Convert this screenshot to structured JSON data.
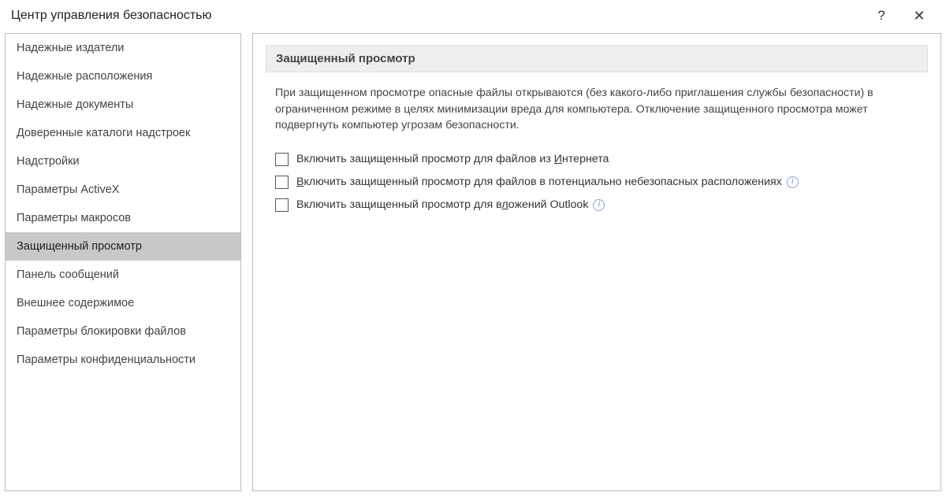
{
  "title": "Центр управления безопасностью",
  "help_glyph": "?",
  "close_glyph": "✕",
  "sidebar": {
    "items": [
      {
        "label": "Надежные издатели"
      },
      {
        "label": "Надежные расположения"
      },
      {
        "label": "Надежные документы"
      },
      {
        "label": "Доверенные каталоги надстроек"
      },
      {
        "label": "Надстройки"
      },
      {
        "label": "Параметры ActiveX"
      },
      {
        "label": "Параметры макросов"
      },
      {
        "label": "Защищенный просмотр"
      },
      {
        "label": "Панель сообщений"
      },
      {
        "label": "Внешнее содержимое"
      },
      {
        "label": "Параметры блокировки файлов"
      },
      {
        "label": "Параметры конфиденциальности"
      }
    ],
    "selected_index": 7
  },
  "main": {
    "section_title": "Защищенный просмотр",
    "description": "При защищенном просмотре опасные файлы открываются (без какого-либо приглашения службы безопасности) в ограниченном режиме в целях минимизации вреда для компьютера. Отключение защищенного просмотра может подвергнуть компьютер угрозам безопасности.",
    "options": [
      {
        "prefix": "Включить защищенный просмотр для файлов из ",
        "hotkey": "И",
        "suffix": "нтернета",
        "checked": false,
        "info": false
      },
      {
        "prefix": "",
        "hotkey": "В",
        "suffix": "ключить защищенный просмотр для файлов в потенциально небезопасных расположениях",
        "checked": false,
        "info": true
      },
      {
        "prefix": "Включить защищенный просмотр для в",
        "hotkey": "л",
        "suffix": "ожений Outlook",
        "checked": false,
        "info": true
      }
    ],
    "info_glyph": "i"
  }
}
